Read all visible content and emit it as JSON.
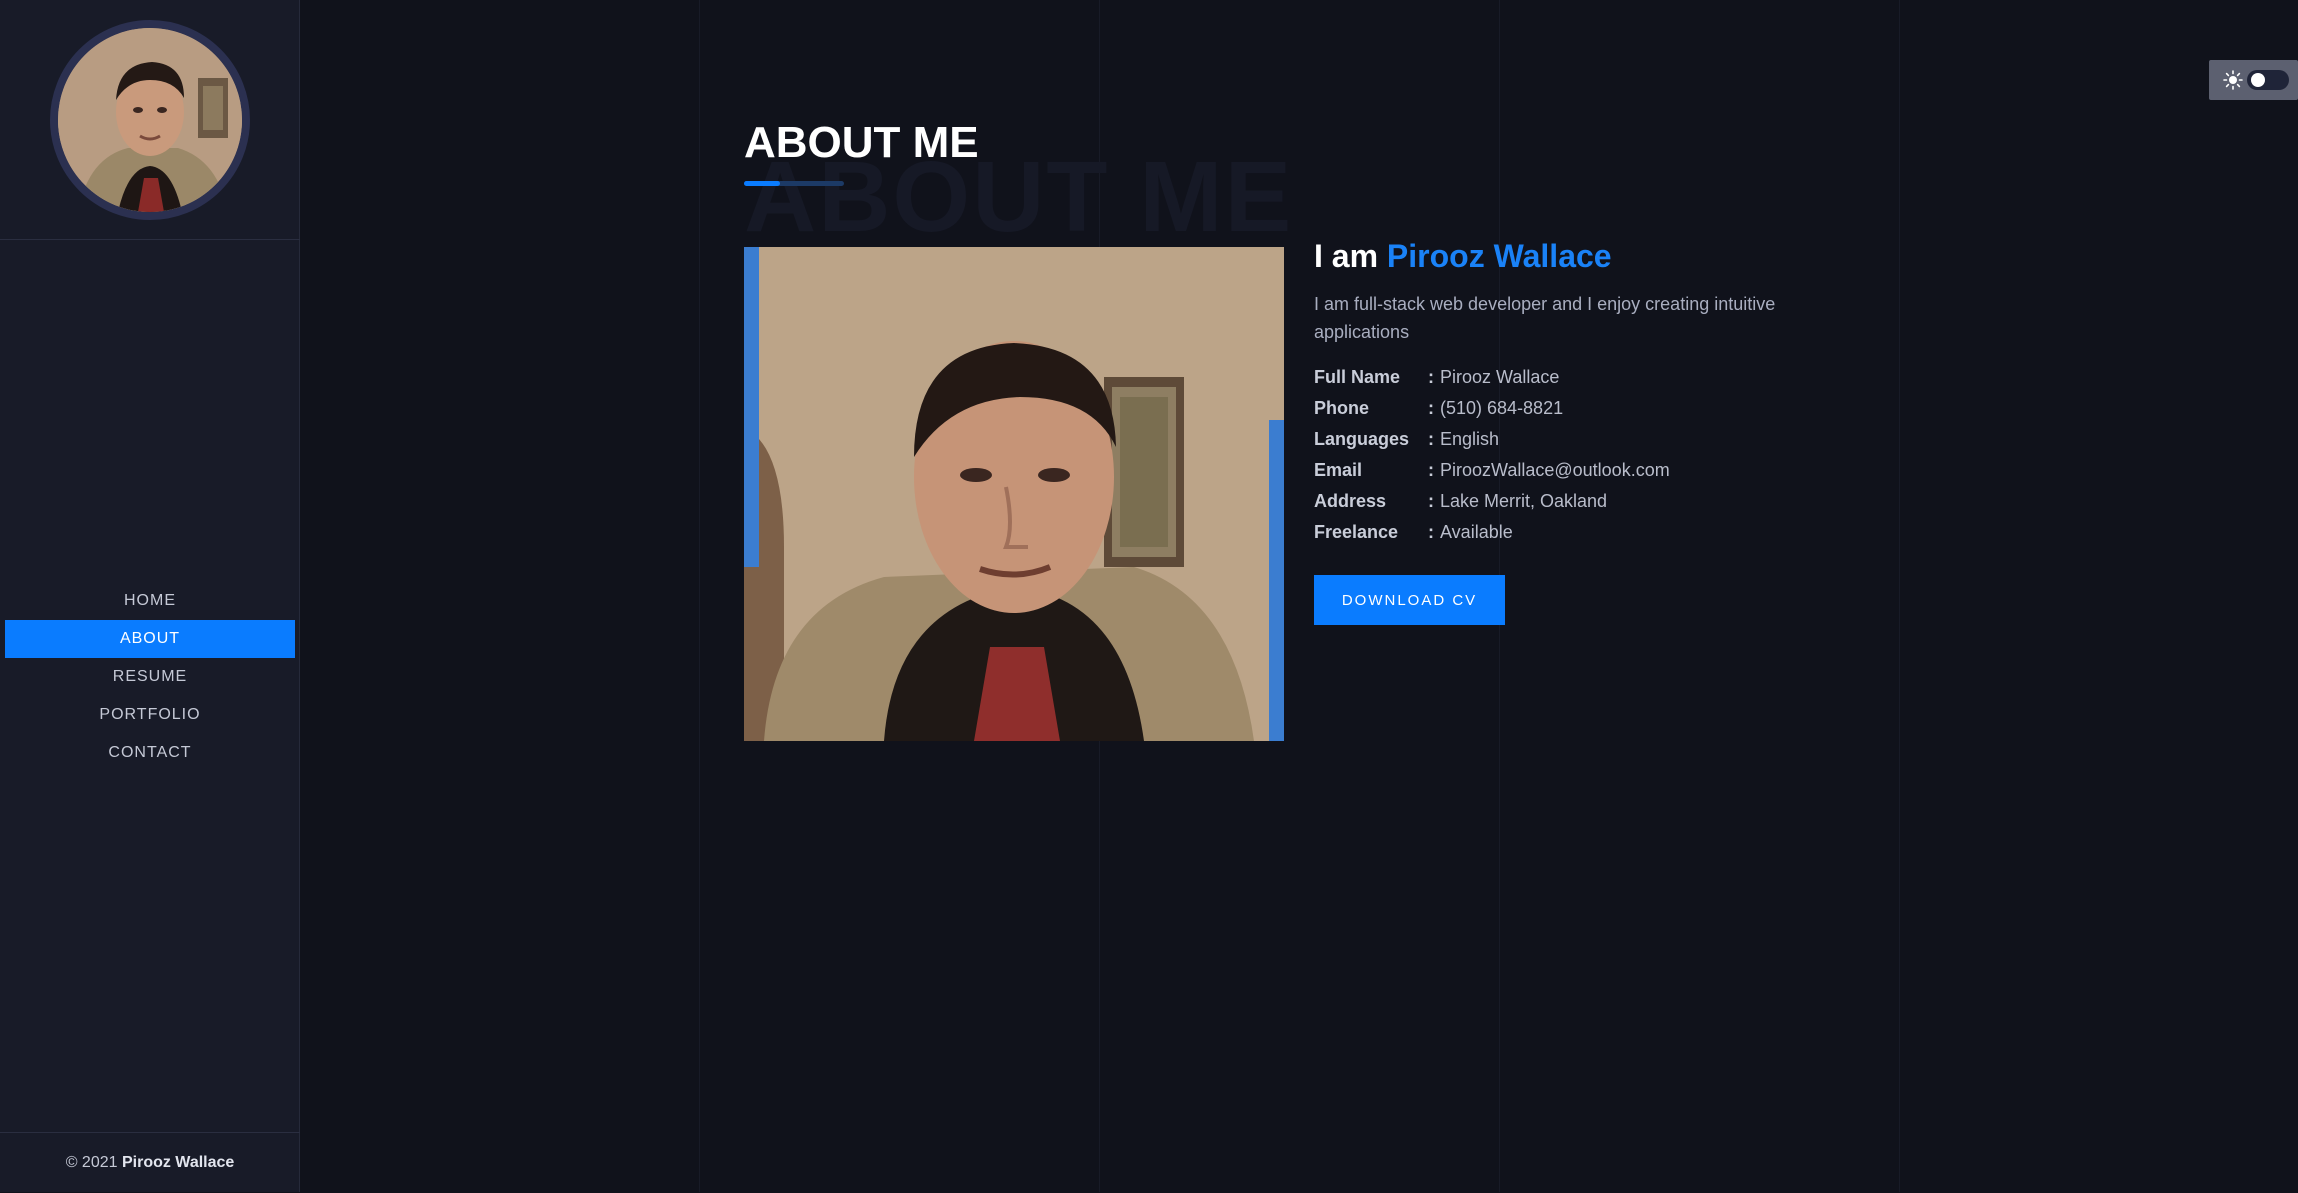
{
  "sidebar": {
    "nav_items": [
      {
        "label": "HOME",
        "active": false
      },
      {
        "label": "ABOUT",
        "active": true
      },
      {
        "label": "RESUME",
        "active": false
      },
      {
        "label": "PORTFOLIO",
        "active": false
      },
      {
        "label": "CONTACT",
        "active": false
      }
    ],
    "footer": {
      "copyright": "© 2021",
      "owner": "Pirooz Wallace"
    }
  },
  "theme_toggle": {
    "icon": "sun-icon",
    "state": "dark"
  },
  "about": {
    "title": "ABOUT ME",
    "bg_title": "ABOUT ME",
    "intro_prefix": "I am",
    "intro_name": "Pirooz Wallace",
    "description": "I am full-stack web developer and I enjoy creating intuitive applications",
    "info": [
      {
        "label": "Full Name",
        "value": "Pirooz Wallace"
      },
      {
        "label": "Phone",
        "value": "(510) 684-8821"
      },
      {
        "label": "Languages",
        "value": "English"
      },
      {
        "label": "Email",
        "value": "PiroozWallace@outlook.com"
      },
      {
        "label": "Address",
        "value": "Lake Merrit, Oakland"
      },
      {
        "label": "Freelance",
        "value": "Available"
      }
    ],
    "download_label": "DOWNLOAD CV"
  },
  "colors": {
    "accent": "#0a7cff",
    "background": "#10121b",
    "sidebar": "#181b28"
  }
}
